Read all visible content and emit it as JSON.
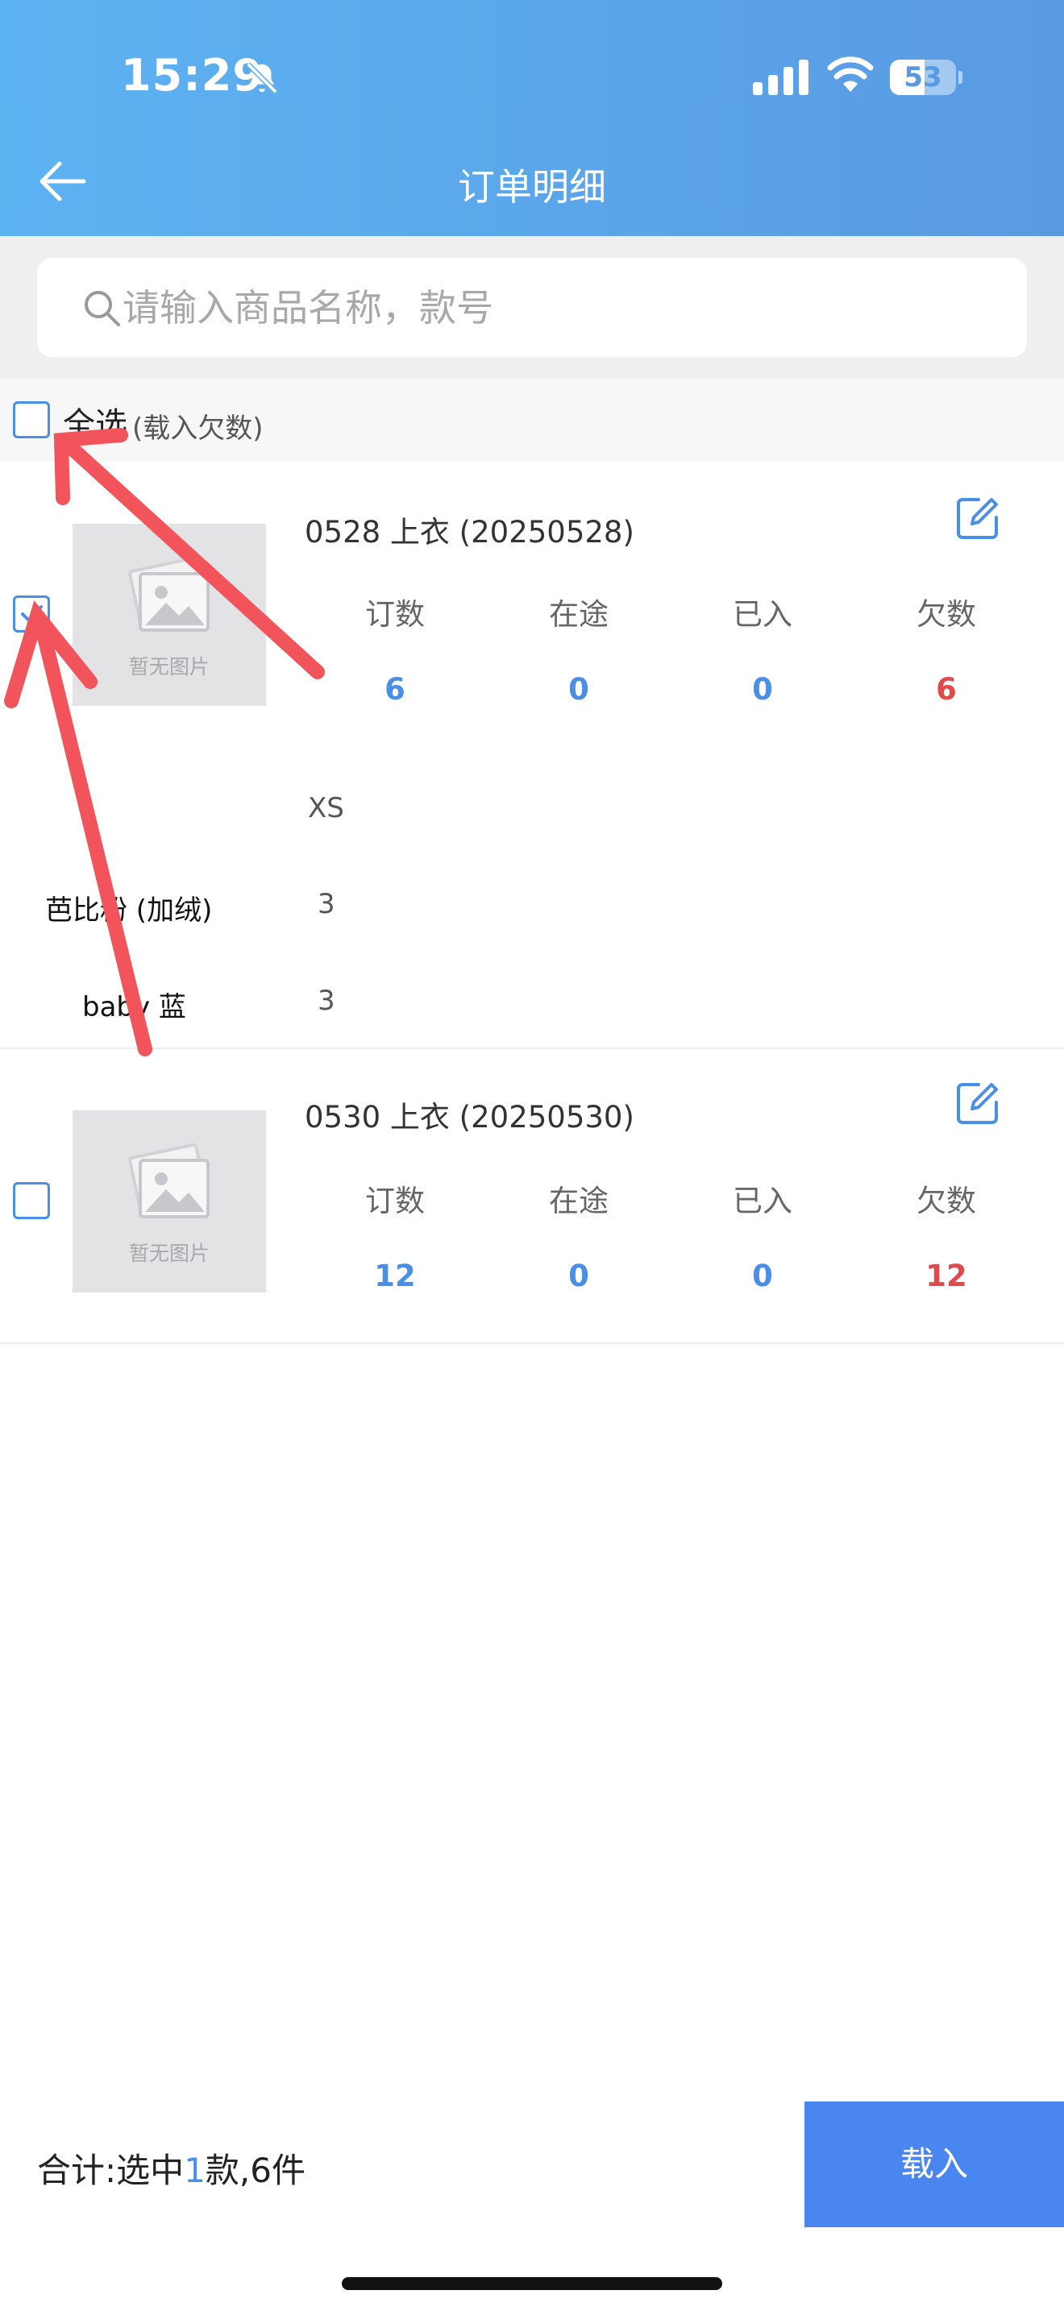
{
  "status_bar": {
    "time": "15:29",
    "battery": "53",
    "battery_level": 0.53
  },
  "header": {
    "title": "订单明细"
  },
  "search": {
    "placeholder": "请输入商品名称，款号",
    "value": ""
  },
  "select_all": {
    "label": "全选",
    "note": "(载入欠数)",
    "checked": false
  },
  "stat_labels": {
    "ordered": "订数",
    "in_transit": "在途",
    "received": "已入",
    "owed": "欠数"
  },
  "items": [
    {
      "title": "0528 上衣 (20250528)",
      "checked": true,
      "thumb_label": "暂无图片",
      "stats": {
        "ordered": "6",
        "in_transit": "0",
        "received": "0",
        "owed": "6"
      },
      "size_header": "XS",
      "color_rows": [
        {
          "color": "芭比粉 (加绒)",
          "qty": "3"
        },
        {
          "color": "baby 蓝",
          "qty": "3"
        }
      ]
    },
    {
      "title": "0530 上衣 (20250530)",
      "checked": false,
      "thumb_label": "暂无图片",
      "stats": {
        "ordered": "12",
        "in_transit": "0",
        "received": "0",
        "owed": "12"
      }
    }
  ],
  "footer": {
    "total_prefix": "合计:选中",
    "selected_count": "1",
    "total_suffix": "款,6件",
    "load_label": "载入"
  },
  "colors": {
    "accent": "#4a8fe6",
    "owed": "#e04a4a",
    "header_start": "#5cb3f2",
    "header_end": "#5a9ae3",
    "arrow": "#f2545b"
  }
}
